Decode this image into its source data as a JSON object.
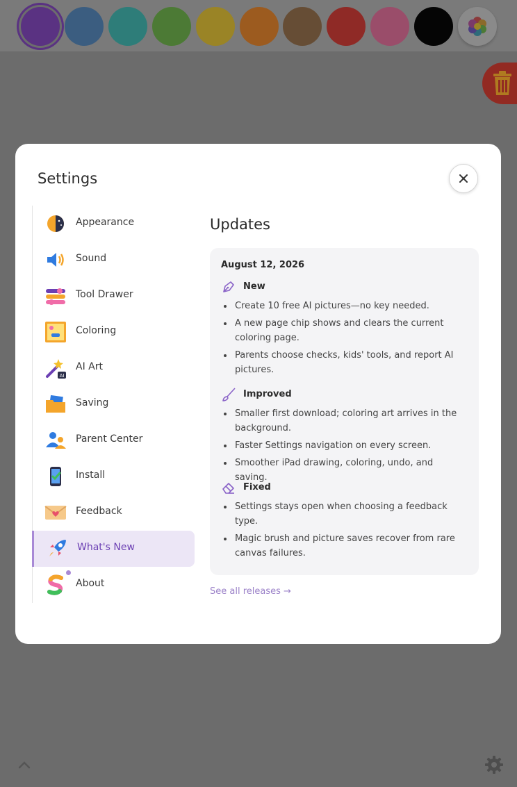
{
  "palette": {
    "swatches": [
      {
        "name": "swatch-purple",
        "color": "#5a3282",
        "selected": true
      },
      {
        "name": "swatch-blue",
        "color": "#3b5d80"
      },
      {
        "name": "swatch-teal",
        "color": "#2e7d79"
      },
      {
        "name": "swatch-green",
        "color": "#4c7a35"
      },
      {
        "name": "swatch-yellow",
        "color": "#9a8426"
      },
      {
        "name": "swatch-orange",
        "color": "#9c5b1f"
      },
      {
        "name": "swatch-brown",
        "color": "#664d35"
      },
      {
        "name": "swatch-red",
        "color": "#8f2a26"
      },
      {
        "name": "swatch-pink",
        "color": "#9a4d6a"
      },
      {
        "name": "swatch-black",
        "color": "#050505"
      },
      {
        "name": "swatch-multicolor",
        "color": "multi"
      }
    ]
  },
  "dialog": {
    "title": "Settings",
    "nav": [
      {
        "key": "appearance",
        "label": "Appearance",
        "icon": "sun-moon-icon"
      },
      {
        "key": "sound",
        "label": "Sound",
        "icon": "speaker-icon"
      },
      {
        "key": "tool-drawer",
        "label": "Tool Drawer",
        "icon": "toggles-icon"
      },
      {
        "key": "coloring",
        "label": "Coloring",
        "icon": "picture-frame-icon"
      },
      {
        "key": "ai-art",
        "label": "AI Art",
        "icon": "magic-wand-icon"
      },
      {
        "key": "saving",
        "label": "Saving",
        "icon": "folder-icon"
      },
      {
        "key": "parent-center",
        "label": "Parent Center",
        "icon": "parents-icon"
      },
      {
        "key": "install",
        "label": "Install",
        "icon": "phone-check-icon"
      },
      {
        "key": "feedback",
        "label": "Feedback",
        "icon": "envelope-heart-icon"
      },
      {
        "key": "whats-new",
        "label": "What's New",
        "icon": "rocket-icon",
        "active": true
      },
      {
        "key": "about",
        "label": "About",
        "icon": "rainbow-s-icon"
      }
    ],
    "updates": {
      "title": "Updates",
      "date": "August 12, 2026",
      "sections": [
        {
          "title": "New",
          "icon": "pen-nib-icon",
          "items": [
            "Create 10 free AI pictures—no key needed.",
            "A new page chip shows and clears the current coloring page.",
            "Parents choose checks, kids' tools, and report AI pictures."
          ]
        },
        {
          "title": "Improved",
          "icon": "brush-icon",
          "items": [
            "Smaller first download; coloring art arrives in the background.",
            "Faster Settings navigation on every screen.",
            "Smoother iPad drawing, coloring, undo, and saving."
          ]
        },
        {
          "title": "Fixed",
          "icon": "eraser-icon",
          "items": [
            "Settings stays open when choosing a feedback type.",
            "Magic brush and picture saves recover from rare canvas failures."
          ]
        }
      ],
      "link": "See all releases →"
    }
  },
  "colors": {
    "accent": "#6b3fb3",
    "active_bg": "#ece6f6",
    "trash": "#922a22"
  }
}
